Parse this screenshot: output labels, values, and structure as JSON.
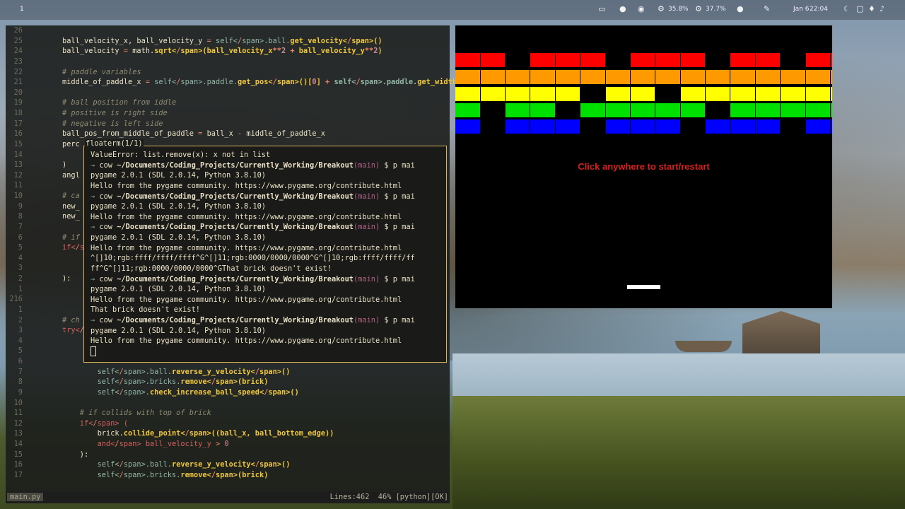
{
  "topbar": {
    "workspace": "1",
    "cpu": "35.8%",
    "mem": "37.7%",
    "date": "Jan 6",
    "time": "22:04",
    "icons": [
      "screen-icon",
      "app-icon",
      "discord-icon",
      "cpu-icon",
      "memory-icon",
      "circle-icon",
      "pen-icon",
      "moon-icon",
      "window-icon",
      "mic-icon",
      "volume-icon"
    ]
  },
  "editor": {
    "lines": [
      {
        "n": "26",
        "t": ""
      },
      {
        "n": "25",
        "t": "ball_velocity_x, ball_velocity_y = self.ball.get_velocity()"
      },
      {
        "n": "24",
        "t": "ball_velocity = math.sqrt(ball_velocity_x**2 + ball_velocity_y**2)"
      },
      {
        "n": "23",
        "t": ""
      },
      {
        "n": "22",
        "t": "# paddle variables"
      },
      {
        "n": "21",
        "t": "middle_of_paddle_x = self.paddle.get_pos()[0] + self.paddle.get_width() / 2"
      },
      {
        "n": "20",
        "t": ""
      },
      {
        "n": "19",
        "t": "# ball position from iddle"
      },
      {
        "n": "18",
        "t": "# positive is right side"
      },
      {
        "n": "17",
        "t": "# negative is left side"
      },
      {
        "n": "16",
        "t": "ball_pos_from_middle_of_paddle = ball_x - middle_of_paddle_x"
      },
      {
        "n": "15",
        "t": "perc"
      },
      {
        "n": "14",
        "t": ""
      },
      {
        "n": "13",
        "t": ")"
      },
      {
        "n": "12",
        "t": "angl"
      },
      {
        "n": "11",
        "t": ""
      },
      {
        "n": "10",
        "t": "# ca"
      },
      {
        "n": "9",
        "t": "new_"
      },
      {
        "n": "8",
        "t": "new_"
      },
      {
        "n": "7",
        "t": ""
      },
      {
        "n": "6",
        "t": "# if"
      },
      {
        "n": "5",
        "t": "if ("
      },
      {
        "n": "4",
        "t": ""
      },
      {
        "n": "3",
        "t": ""
      },
      {
        "n": "2",
        "t": "):"
      },
      {
        "n": "1",
        "t": ""
      },
      {
        "n": "216",
        "t": ""
      },
      {
        "n": "1",
        "t": ""
      },
      {
        "n": "2",
        "t": "# ch"
      },
      {
        "n": "3",
        "t": "try:"
      },
      {
        "n": "4",
        "t": ""
      },
      {
        "n": "5",
        "t": ""
      },
      {
        "n": "6",
        "t": ""
      },
      {
        "n": "7",
        "t": "        self.ball.reverse_y_velocity()"
      },
      {
        "n": "8",
        "t": "        self.bricks.remove(brick)"
      },
      {
        "n": "9",
        "t": "        self.check_increase_ball_speed()"
      },
      {
        "n": "10",
        "t": ""
      },
      {
        "n": "11",
        "t": "    # if collids with top of brick"
      },
      {
        "n": "12",
        "t": "    if ("
      },
      {
        "n": "13",
        "t": "        brick.collide_point((ball_x, ball_bottom_edge))"
      },
      {
        "n": "14",
        "t": "        and ball_velocity_y > 0"
      },
      {
        "n": "15",
        "t": "    ):"
      },
      {
        "n": "16",
        "t": "        self.ball.reverse_y_velocity()"
      },
      {
        "n": "17",
        "t": "        self.bricks.remove(brick)"
      }
    ],
    "status_filename": "main.py",
    "status_right": "Lines:462  46% [python][OK]"
  },
  "floaterm": {
    "title": "floaterm(1/1)",
    "lines": [
      {
        "type": "text",
        "t": "ValueError: list.remove(x): x not in list"
      },
      {
        "type": "prompt",
        "user": "cow",
        "path": "~/Documents/Coding_Projects/Currently_Working/Breakout",
        "branch": "(main)",
        "cmd": " $ p mai"
      },
      {
        "type": "text",
        "t": "pygame 2.0.1 (SDL 2.0.14, Python 3.8.10)"
      },
      {
        "type": "text",
        "t": "Hello from the pygame community. https://www.pygame.org/contribute.html"
      },
      {
        "type": "prompt",
        "user": "cow",
        "path": "~/Documents/Coding_Projects/Currently_Working/Breakout",
        "branch": "(main)",
        "cmd": " $ p mai"
      },
      {
        "type": "text",
        "t": "pygame 2.0.1 (SDL 2.0.14, Python 3.8.10)"
      },
      {
        "type": "text",
        "t": "Hello from the pygame community. https://www.pygame.org/contribute.html"
      },
      {
        "type": "prompt",
        "user": "cow",
        "path": "~/Documents/Coding_Projects/Currently_Working/Breakout",
        "branch": "(main)",
        "cmd": " $ p mai"
      },
      {
        "type": "text",
        "t": "pygame 2.0.1 (SDL 2.0.14, Python 3.8.10)"
      },
      {
        "type": "text",
        "t": "Hello from the pygame community. https://www.pygame.org/contribute.html"
      },
      {
        "type": "text",
        "t": "^[]10;rgb:ffff/ffff/ffff^G^[]11;rgb:0000/0000/0000^G^[]10;rgb:ffff/ffff/ff"
      },
      {
        "type": "text",
        "t": "ff^G^[]11;rgb:0000/0000/0000^GThat brick doesn't exist!"
      },
      {
        "type": "prompt",
        "user": "cow",
        "path": "~/Documents/Coding_Projects/Currently_Working/Breakout",
        "branch": "(main)",
        "cmd": " $ p mai"
      },
      {
        "type": "text",
        "t": "pygame 2.0.1 (SDL 2.0.14, Python 3.8.10)"
      },
      {
        "type": "text",
        "t": "Hello from the pygame community. https://www.pygame.org/contribute.html"
      },
      {
        "type": "text",
        "t": "That brick doesn't exist!"
      },
      {
        "type": "prompt",
        "user": "cow",
        "path": "~/Documents/Coding_Projects/Currently_Working/Breakout",
        "branch": "(main)",
        "cmd": " $ p mai"
      },
      {
        "type": "text",
        "t": "pygame 2.0.1 (SDL 2.0.14, Python 3.8.10)"
      },
      {
        "type": "text",
        "t": "Hello from the pygame community. https://www.pygame.org/contribute.html"
      },
      {
        "type": "cursor",
        "t": ""
      }
    ]
  },
  "game": {
    "message": "Click anywhere to start/restart",
    "colors": {
      "red": "#ff0000",
      "orange": "#ff9900",
      "yellow": "#ffff00",
      "green": "#00e000",
      "blue": "#0000ff"
    },
    "rows": [
      {
        "color": "red",
        "segments": [
          [
            0,
            35
          ],
          [
            36,
            70
          ],
          [
            71,
            105
          ],
          [
            106,
            141
          ],
          [
            142,
            176
          ],
          [
            177,
            212
          ],
          [
            213,
            247
          ],
          [
            248,
            282
          ],
          [
            283,
            318
          ],
          [
            319,
            353
          ],
          [
            354,
            388
          ],
          [
            389,
            424
          ],
          [
            425,
            459
          ],
          [
            460,
            495
          ],
          [
            496,
            530
          ],
          [
            531,
            540
          ]
        ],
        "present": [
          1,
          1,
          0,
          1,
          1,
          1,
          0,
          1,
          1,
          1,
          0,
          1,
          1,
          0,
          1,
          1
        ]
      },
      {
        "color": "orange",
        "segments": [
          [
            0,
            35
          ],
          [
            36,
            70
          ],
          [
            71,
            105
          ],
          [
            106,
            141
          ],
          [
            142,
            176
          ],
          [
            177,
            212
          ],
          [
            213,
            247
          ],
          [
            248,
            282
          ],
          [
            283,
            318
          ],
          [
            319,
            353
          ],
          [
            354,
            388
          ],
          [
            389,
            424
          ],
          [
            425,
            459
          ],
          [
            460,
            495
          ],
          [
            496,
            530
          ],
          [
            531,
            540
          ]
        ],
        "present": [
          1,
          1,
          1,
          1,
          1,
          1,
          1,
          1,
          1,
          1,
          1,
          1,
          1,
          1,
          1,
          1
        ]
      },
      {
        "color": "yellow",
        "segments": [
          [
            0,
            35
          ],
          [
            36,
            70
          ],
          [
            71,
            105
          ],
          [
            106,
            141
          ],
          [
            142,
            176
          ],
          [
            177,
            212
          ],
          [
            213,
            247
          ],
          [
            248,
            282
          ],
          [
            283,
            318
          ],
          [
            319,
            353
          ],
          [
            354,
            388
          ],
          [
            389,
            424
          ],
          [
            425,
            459
          ],
          [
            460,
            495
          ],
          [
            496,
            530
          ],
          [
            531,
            540
          ]
        ],
        "present": [
          1,
          1,
          1,
          1,
          1,
          0,
          1,
          1,
          0,
          1,
          1,
          1,
          1,
          1,
          1,
          1
        ]
      },
      {
        "color": "green",
        "segments": [
          [
            0,
            35
          ],
          [
            36,
            70
          ],
          [
            71,
            105
          ],
          [
            106,
            141
          ],
          [
            142,
            176
          ],
          [
            177,
            212
          ],
          [
            213,
            247
          ],
          [
            248,
            282
          ],
          [
            283,
            318
          ],
          [
            319,
            353
          ],
          [
            354,
            388
          ],
          [
            389,
            424
          ],
          [
            425,
            459
          ],
          [
            460,
            495
          ],
          [
            496,
            530
          ],
          [
            531,
            540
          ]
        ],
        "present": [
          1,
          0,
          1,
          1,
          0,
          1,
          1,
          1,
          1,
          1,
          0,
          1,
          1,
          1,
          1,
          1
        ]
      },
      {
        "color": "blue",
        "segments": [
          [
            0,
            35
          ],
          [
            36,
            70
          ],
          [
            71,
            105
          ],
          [
            106,
            141
          ],
          [
            142,
            176
          ],
          [
            177,
            212
          ],
          [
            213,
            247
          ],
          [
            248,
            282
          ],
          [
            283,
            318
          ],
          [
            319,
            353
          ],
          [
            354,
            388
          ],
          [
            389,
            424
          ],
          [
            425,
            459
          ],
          [
            460,
            495
          ],
          [
            496,
            530
          ],
          [
            531,
            540
          ]
        ],
        "present": [
          1,
          0,
          1,
          1,
          1,
          0,
          1,
          1,
          1,
          0,
          1,
          1,
          1,
          0,
          1,
          1
        ]
      }
    ]
  }
}
